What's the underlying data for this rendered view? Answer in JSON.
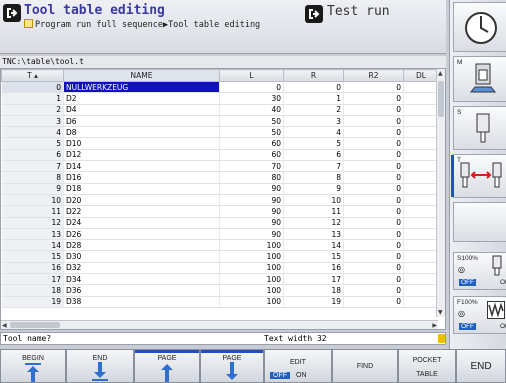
{
  "header": {
    "mode_title": "Tool table editing",
    "mode_sub": "Program run full sequence",
    "mode_sub_after": "Tool table editing",
    "mode_right_title": "Test run"
  },
  "path": "TNC:\\table\\tool.t",
  "table": {
    "columns": [
      "T",
      "NAME",
      "L",
      "R",
      "R2",
      "DL"
    ],
    "rows": [
      {
        "t": "0",
        "name": "NULLWERKZEUG",
        "l": "0",
        "r": "0",
        "r2": "0"
      },
      {
        "t": "1",
        "name": "D2",
        "l": "30",
        "r": "1",
        "r2": "0"
      },
      {
        "t": "2",
        "name": "D4",
        "l": "40",
        "r": "2",
        "r2": "0"
      },
      {
        "t": "3",
        "name": "D6",
        "l": "50",
        "r": "3",
        "r2": "0"
      },
      {
        "t": "4",
        "name": "D8",
        "l": "50",
        "r": "4",
        "r2": "0"
      },
      {
        "t": "5",
        "name": "D10",
        "l": "60",
        "r": "5",
        "r2": "0"
      },
      {
        "t": "6",
        "name": "D12",
        "l": "60",
        "r": "6",
        "r2": "0"
      },
      {
        "t": "7",
        "name": "D14",
        "l": "70",
        "r": "7",
        "r2": "0"
      },
      {
        "t": "8",
        "name": "D16",
        "l": "80",
        "r": "8",
        "r2": "0"
      },
      {
        "t": "9",
        "name": "D18",
        "l": "90",
        "r": "9",
        "r2": "0"
      },
      {
        "t": "10",
        "name": "D20",
        "l": "90",
        "r": "10",
        "r2": "0"
      },
      {
        "t": "11",
        "name": "D22",
        "l": "90",
        "r": "11",
        "r2": "0"
      },
      {
        "t": "12",
        "name": "D24",
        "l": "90",
        "r": "12",
        "r2": "0"
      },
      {
        "t": "13",
        "name": "D26",
        "l": "90",
        "r": "13",
        "r2": "0"
      },
      {
        "t": "14",
        "name": "D28",
        "l": "100",
        "r": "14",
        "r2": "0"
      },
      {
        "t": "15",
        "name": "D30",
        "l": "100",
        "r": "15",
        "r2": "0"
      },
      {
        "t": "16",
        "name": "D32",
        "l": "100",
        "r": "16",
        "r2": "0"
      },
      {
        "t": "17",
        "name": "D34",
        "l": "100",
        "r": "17",
        "r2": "0"
      },
      {
        "t": "18",
        "name": "D36",
        "l": "100",
        "r": "18",
        "r2": "0"
      },
      {
        "t": "19",
        "name": "D38",
        "l": "100",
        "r": "19",
        "r2": "0"
      }
    ]
  },
  "status": {
    "left": "Tool name?",
    "mid": "Text width 32"
  },
  "softkeys": {
    "begin": "BEGIN",
    "end_arrow": "END",
    "page1": "PAGE",
    "page2": "PAGE",
    "edit": "EDIT",
    "edit_off": "OFF",
    "edit_on": "ON",
    "find": "FIND",
    "pocket": "POCKET",
    "pocket2": "TABLE",
    "end": "END"
  },
  "rpanel": {
    "m_label": "M",
    "s_label": "S",
    "t_label": "T",
    "s100": "S100%",
    "f100": "F100%",
    "off": "OFF",
    "on": "ON"
  },
  "colors": {
    "accent": "#2050c0",
    "selection": "#1010c0",
    "title": "#3a3aa0"
  }
}
